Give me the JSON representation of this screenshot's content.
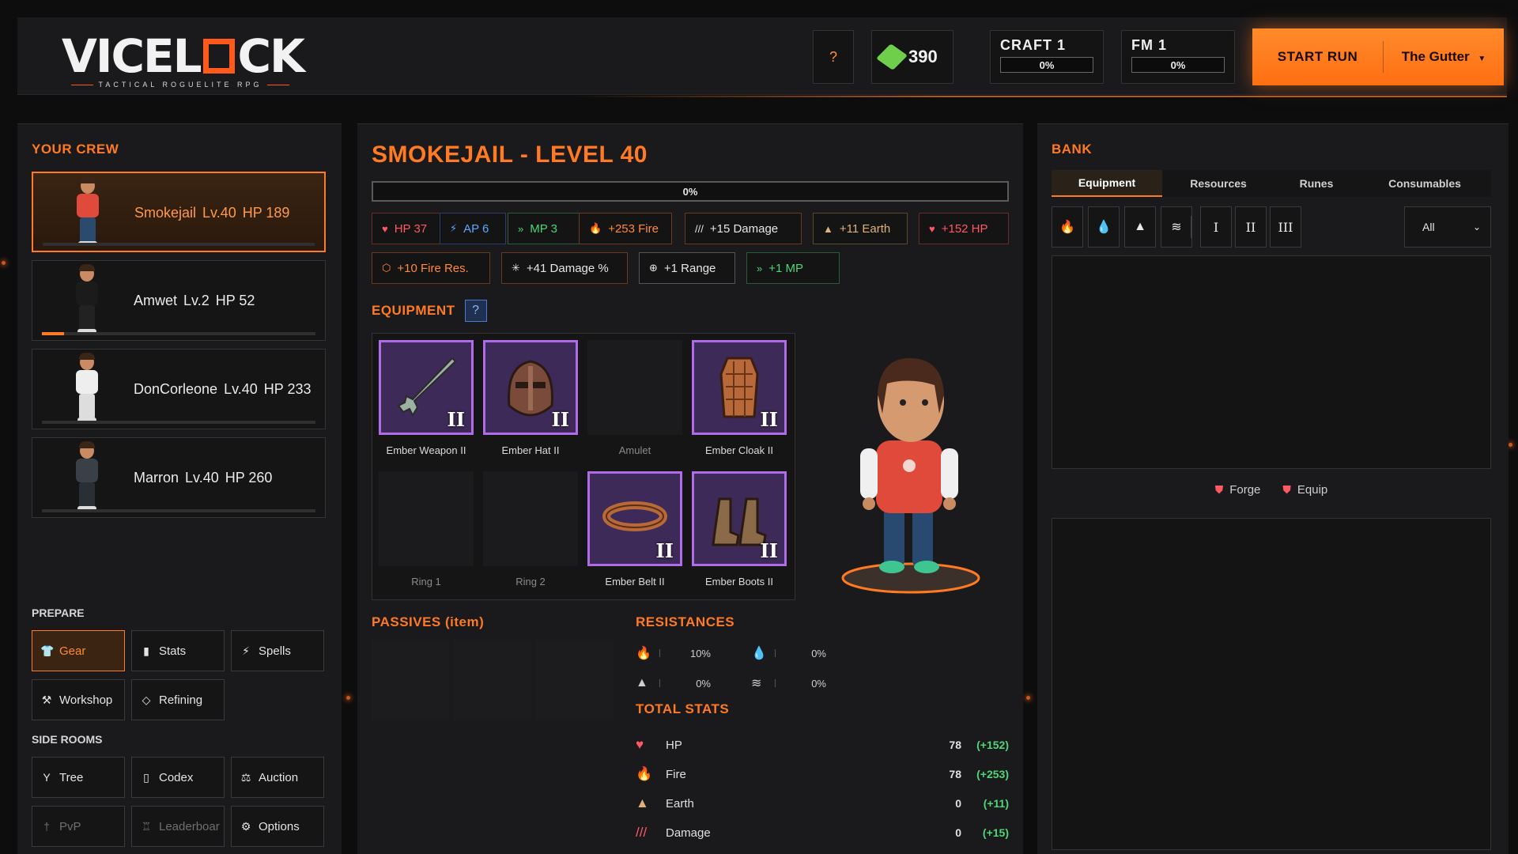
{
  "header": {
    "logo_text_left": "VICEL",
    "logo_text_right": "CK",
    "logo_tagline": "TACTICAL ROGUELITE RPG",
    "help_label": "?",
    "gems": "390",
    "craft": {
      "label": "CRAFT 1",
      "progress": "0%"
    },
    "fm": {
      "label": "FM 1",
      "progress": "0%"
    },
    "start_run": {
      "label": "START RUN",
      "zone": "The Gutter",
      "dropdown_icon": "caret-down-icon"
    },
    "accent_color": "#ff7a22"
  },
  "crew": {
    "title": "YOUR CREW",
    "members": [
      {
        "name": "Smokejail",
        "level": "Lv.40",
        "hp": "HP 189",
        "xp_fraction": 0.0,
        "active": true,
        "shirt": "#e04a3a",
        "pants": "#2a4a6e"
      },
      {
        "name": "Amwet",
        "level": "Lv.2",
        "hp": "HP 52",
        "xp_fraction": 0.08,
        "active": false,
        "shirt": "#1b1b1b",
        "pants": "#222"
      },
      {
        "name": "DonCorleone",
        "level": "Lv.40",
        "hp": "HP 233",
        "xp_fraction": 0.0,
        "active": false,
        "shirt": "#eeeeee",
        "pants": "#dddddd"
      },
      {
        "name": "Marron",
        "level": "Lv.40",
        "hp": "HP 260",
        "xp_fraction": 0.0,
        "active": false,
        "shirt": "#3a4048",
        "pants": "#2a2f36"
      }
    ]
  },
  "prepare": {
    "title": "PREPARE",
    "buttons": [
      {
        "label": "Gear",
        "icon": "shirt-icon",
        "glyph": "👕",
        "active": true
      },
      {
        "label": "Stats",
        "icon": "stats-icon",
        "glyph": "▮",
        "active": false
      },
      {
        "label": "Spells",
        "icon": "lightning-icon",
        "glyph": "⚡",
        "active": false
      },
      {
        "label": "Workshop",
        "icon": "anvil-icon",
        "glyph": "⚒",
        "active": false
      },
      {
        "label": "Refining",
        "icon": "gem-icon",
        "glyph": "◇",
        "active": false
      }
    ]
  },
  "side_rooms": {
    "title": "SIDE ROOMS",
    "buttons": [
      {
        "label": "Tree",
        "icon": "tree-icon",
        "glyph": "Y",
        "disabled": false
      },
      {
        "label": "Codex",
        "icon": "book-icon",
        "glyph": "▯",
        "disabled": false
      },
      {
        "label": "Auction",
        "icon": "gavel-icon",
        "glyph": "⚖",
        "disabled": false
      },
      {
        "label": "PvP",
        "icon": "sword-icon",
        "glyph": "†",
        "disabled": true
      },
      {
        "label": "Leaderboar",
        "icon": "trophy-icon",
        "glyph": "♖",
        "disabled": true
      },
      {
        "label": "Options",
        "icon": "gear-icon",
        "glyph": "⚙",
        "disabled": false
      }
    ]
  },
  "character": {
    "title": "SMOKEJAIL - LEVEL 40",
    "xp_progress": "0%",
    "stat_chips": [
      {
        "label": "HP 37",
        "icon": "heart-icon",
        "glyph": "♥",
        "tone": "red"
      },
      {
        "label": "AP 6",
        "icon": "lightning-icon",
        "glyph": "⚡",
        "tone": "blue"
      },
      {
        "label": "MP 3",
        "icon": "chevrons-icon",
        "glyph": "»",
        "tone": "green"
      },
      {
        "label": "+253 Fire",
        "icon": "fire-icon",
        "glyph": "🔥",
        "tone": "orange"
      },
      {
        "label": "+15 Damage",
        "icon": "claw-icon",
        "glyph": "///",
        "tone": "white2"
      },
      {
        "label": "+11 Earth",
        "icon": "mountain-icon",
        "glyph": "▲",
        "tone": "earth"
      },
      {
        "label": "+152 HP",
        "icon": "heart-icon",
        "glyph": "♥",
        "tone": "red"
      },
      {
        "label": "+10 Fire Res.",
        "icon": "shield-icon",
        "glyph": "⬡",
        "tone": "orange"
      },
      {
        "label": "+41 Damage %",
        "icon": "burst-icon",
        "glyph": "✳",
        "tone": "white2"
      },
      {
        "label": "+1 Range",
        "icon": "crosshair-icon",
        "glyph": "⊕",
        "tone": "white"
      },
      {
        "label": "+1 MP",
        "icon": "chevrons-icon",
        "glyph": "»",
        "tone": "green"
      }
    ]
  },
  "equipment": {
    "title": "EQUIPMENT",
    "help_label": "?",
    "slots": [
      {
        "label": "Ember Weapon II",
        "filled": true,
        "tier": "II",
        "icon": "sword-icon"
      },
      {
        "label": "Ember Hat II",
        "filled": true,
        "tier": "II",
        "icon": "helmet-icon"
      },
      {
        "label": "Amulet",
        "filled": false,
        "tier": "",
        "icon": ""
      },
      {
        "label": "Ember Cloak II",
        "filled": true,
        "tier": "II",
        "icon": "cloak-icon"
      },
      {
        "label": "Ring 1",
        "filled": false,
        "tier": "",
        "icon": ""
      },
      {
        "label": "Ring 2",
        "filled": false,
        "tier": "",
        "icon": ""
      },
      {
        "label": "Ember Belt II",
        "filled": true,
        "tier": "II",
        "icon": "belt-icon"
      },
      {
        "label": "Ember Boots II",
        "filled": true,
        "tier": "II",
        "icon": "boots-icon"
      }
    ]
  },
  "passives": {
    "title": "PASSIVES (item)"
  },
  "resistances": {
    "title": "RESISTANCES",
    "items": [
      {
        "icon": "fire-icon",
        "glyph": "🔥",
        "value": "10%"
      },
      {
        "icon": "water-icon",
        "glyph": "💧",
        "value": "0%"
      },
      {
        "icon": "mountain-icon",
        "glyph": "▲",
        "value": "0%"
      },
      {
        "icon": "wind-icon",
        "glyph": "≋",
        "value": "0%"
      }
    ]
  },
  "total_stats": {
    "title": "TOTAL STATS",
    "rows": [
      {
        "name": "HP",
        "icon": "heart-icon",
        "glyph": "♥",
        "color": "#ff5a64",
        "value": "78",
        "bonus": "(+152)"
      },
      {
        "name": "Fire",
        "icon": "fire-icon",
        "glyph": "🔥",
        "color": "#ff8a3a",
        "value": "78",
        "bonus": "(+253)"
      },
      {
        "name": "Earth",
        "icon": "mountain-icon",
        "glyph": "▲",
        "color": "#e0b27a",
        "value": "0",
        "bonus": "(+11)"
      },
      {
        "name": "Damage",
        "icon": "claw-icon",
        "glyph": "///",
        "color": "#ff5a64",
        "value": "0",
        "bonus": "(+15)"
      }
    ]
  },
  "bank": {
    "title": "BANK",
    "tabs": [
      "Equipment",
      "Resources",
      "Runes",
      "Consumables"
    ],
    "active_tab": 0,
    "filters": [
      {
        "icon": "fire-icon",
        "glyph": "🔥"
      },
      {
        "icon": "water-icon",
        "glyph": "💧"
      },
      {
        "icon": "mountain-icon",
        "glyph": "▲"
      },
      {
        "icon": "wind-icon",
        "glyph": "≋"
      },
      {
        "icon": "tier-1-icon",
        "glyph": "I"
      },
      {
        "icon": "tier-2-icon",
        "glyph": "II"
      },
      {
        "icon": "tier-3-icon",
        "glyph": "III"
      }
    ],
    "select_value": "All",
    "actions": [
      {
        "label": "Forge",
        "icon": "forge-icon",
        "glyph": "⛊"
      },
      {
        "label": "Equip",
        "icon": "equip-icon",
        "glyph": "⛊"
      }
    ]
  }
}
